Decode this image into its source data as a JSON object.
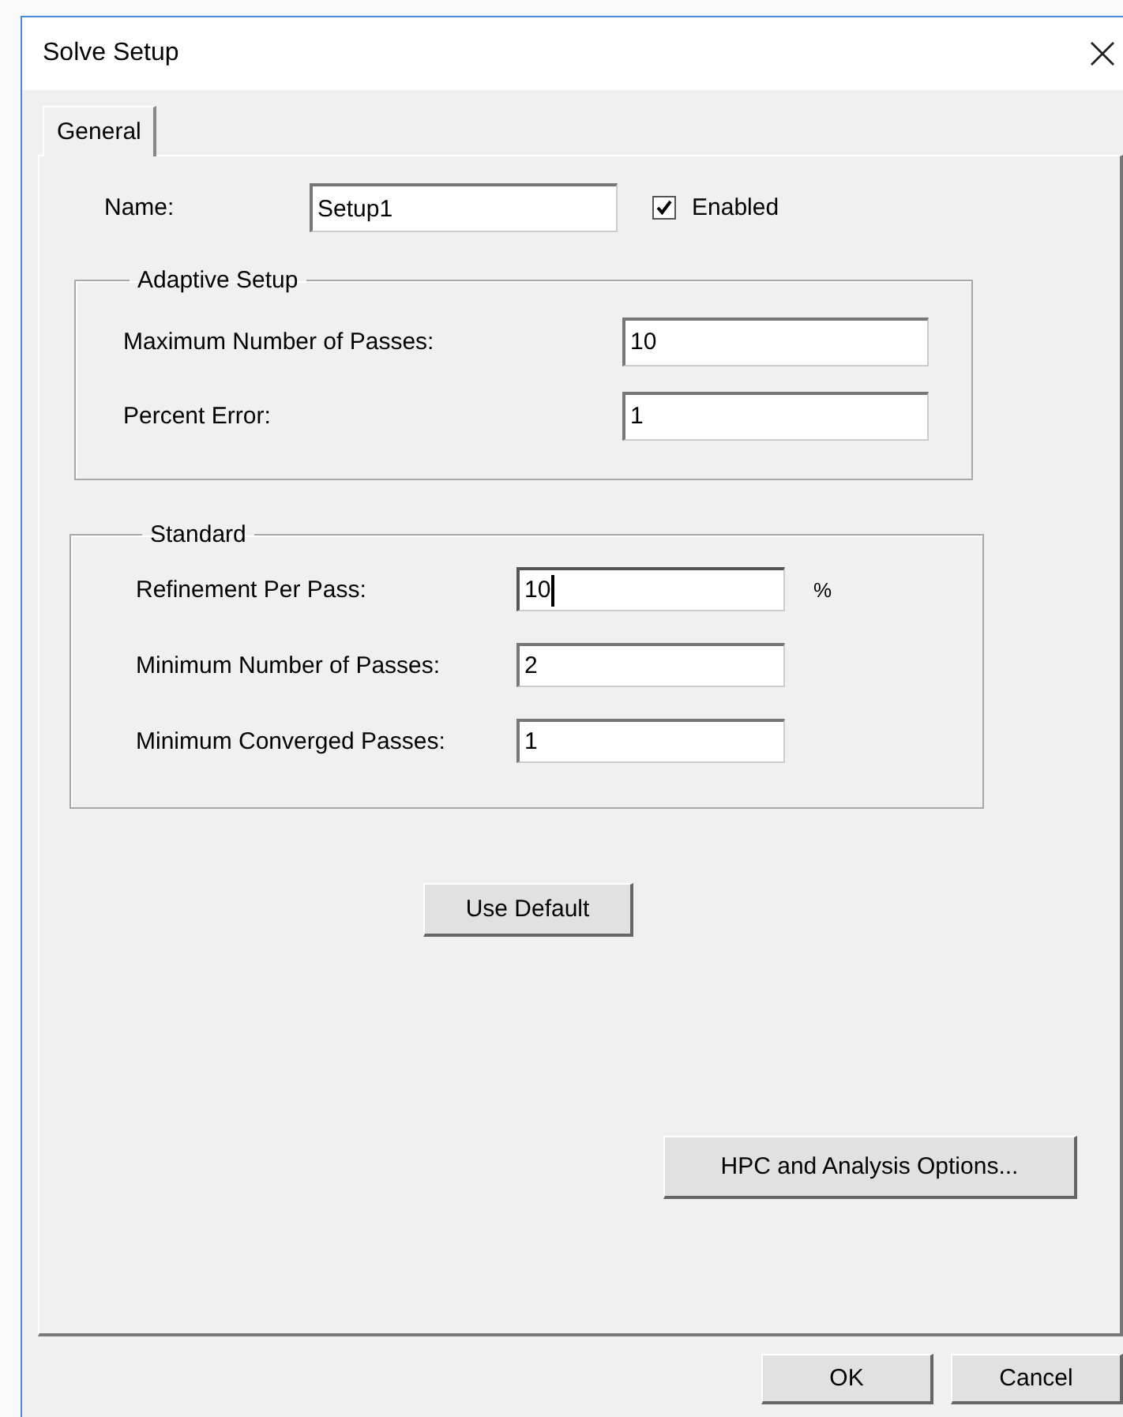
{
  "window": {
    "title": "Solve Setup"
  },
  "tabs": [
    {
      "label": "General",
      "selected": true
    }
  ],
  "name_field": {
    "label": "Name:",
    "value": "Setup1"
  },
  "enabled": {
    "label": "Enabled",
    "checked": true
  },
  "groups": [
    {
      "title": "Adaptive Setup",
      "rows": [
        {
          "label": "Maximum Number of Passes:",
          "value": "10",
          "focused": false
        },
        {
          "label": "Percent Error:",
          "value": "1",
          "focused": false
        }
      ]
    },
    {
      "title": "Standard",
      "rows": [
        {
          "label": "Refinement Per Pass:",
          "value": "10",
          "unit": "%",
          "focused": true
        },
        {
          "label": "Minimum Number of Passes:",
          "value": "2",
          "focused": false
        },
        {
          "label": "Minimum Converged Passes:",
          "value": "1",
          "focused": false
        }
      ]
    }
  ],
  "use_default_button": "Use Default",
  "hpc_button": "HPC and Analysis Options...",
  "footer_buttons": [
    "OK",
    "Cancel"
  ]
}
